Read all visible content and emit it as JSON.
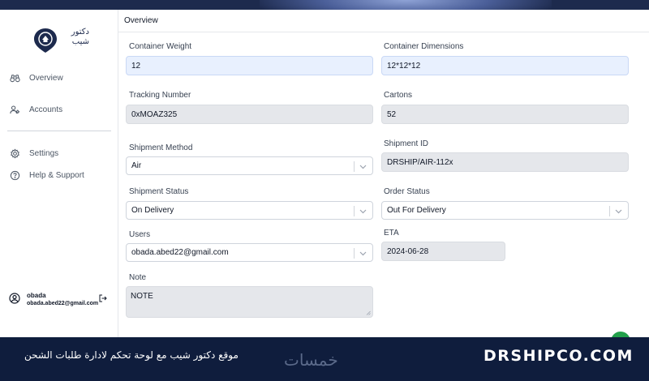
{
  "app": {
    "logo_text_line1": "دكتور",
    "logo_text_line2": "شيب"
  },
  "sidebar": {
    "items": [
      {
        "label": "Overview",
        "icon": "binoculars-icon"
      },
      {
        "label": "Accounts",
        "icon": "users-icon"
      },
      {
        "label": "Settings",
        "icon": "gear-icon"
      },
      {
        "label": "Help & Support",
        "icon": "question-icon"
      }
    ],
    "user": {
      "name": "obada",
      "email": "obada.abed22@gmail.com"
    }
  },
  "page": {
    "title": "Overview"
  },
  "form": {
    "container_weight": {
      "label": "Container Weight",
      "value": "12"
    },
    "container_dimensions": {
      "label": "Container Dimensions",
      "value": "12*12*12"
    },
    "tracking_number": {
      "label": "Tracking Number",
      "value": "0xMOAZ325"
    },
    "cartons": {
      "label": "Cartons",
      "value": "52"
    },
    "shipment_method": {
      "label": "Shipment Method",
      "value": "Air"
    },
    "shipment_id": {
      "label": "Shipment ID",
      "value": "DRSHIP/AIR-112x"
    },
    "shipment_status": {
      "label": "Shipment Status",
      "value": "On Delivery"
    },
    "order_status": {
      "label": "Order Status",
      "value": "Out For Delivery"
    },
    "users": {
      "label": "Users",
      "value": "obada.abed22@gmail.com"
    },
    "eta": {
      "label": "ETA",
      "value": "2024-06-28"
    },
    "note": {
      "label": "Note",
      "value": "NOTE"
    }
  },
  "banner": {
    "arabic_caption": "موقع دكتور شيب مع لوحة تحكم لادارة طلبات الشحن",
    "brand_arabic": "خمسات",
    "site": "DRSHIPCO.COM"
  },
  "colors": {
    "navy": "#1d2a4d",
    "banner": "#0f1d3d",
    "input_blue": "#e8f0fe",
    "input_gray": "#e5e7eb",
    "fab_green": "#22a04b"
  }
}
